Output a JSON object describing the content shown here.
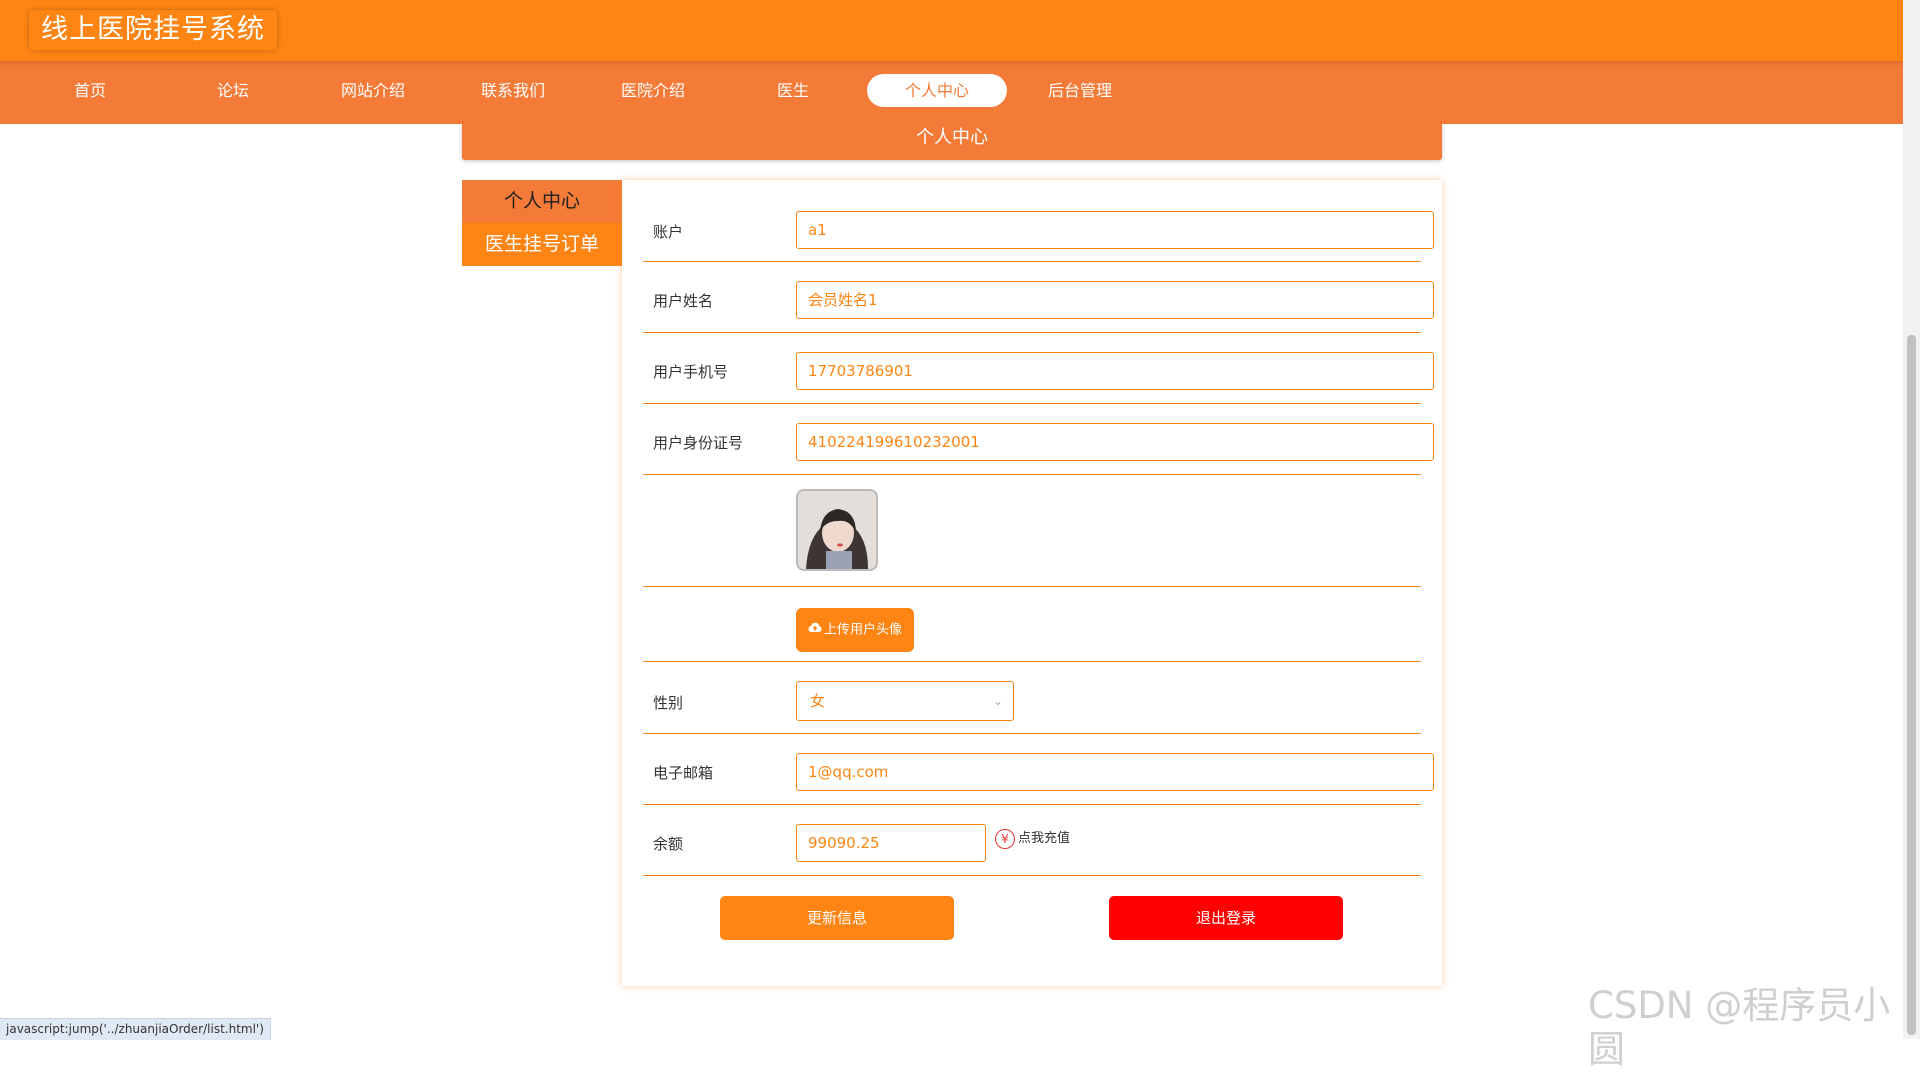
{
  "header": {
    "site_title": "线上医院挂号系统"
  },
  "nav": {
    "items": [
      "首页",
      "论坛",
      "网站介绍",
      "联系我们",
      "医院介绍",
      "医生",
      "个人中心",
      "后台管理"
    ],
    "active": "个人中心"
  },
  "page_heading": "个人中心",
  "side_menu": {
    "items": [
      "个人中心",
      "医生挂号订单"
    ]
  },
  "form": {
    "account": {
      "label": "账户",
      "value": "a1"
    },
    "name": {
      "label": "用户姓名",
      "value": "会员姓名1"
    },
    "phone": {
      "label": "用户手机号",
      "value": "17703786901"
    },
    "id_card": {
      "label": "用户身份证号",
      "value": "410224199610232001"
    },
    "upload_label": "上传用户头像",
    "gender": {
      "label": "性别",
      "value": "女"
    },
    "email": {
      "label": "电子邮箱",
      "value": "1@qq.com"
    },
    "balance": {
      "label": "余额",
      "value": "99090.25",
      "recharge": "点我充值"
    }
  },
  "buttons": {
    "update": "更新信息",
    "logout": "退出登录"
  },
  "status_bar": "javascript:jump('../zhuanjiaOrder/list.html')",
  "watermark": "CSDN @程序员小圆",
  "colors": {
    "primary": "#fe8514",
    "nav": "#f47a37",
    "danger": "#fe0000"
  },
  "icons": {
    "upload": "cloud-upload-icon",
    "recharge": "yen-icon",
    "select": "chevron-down-icon"
  }
}
